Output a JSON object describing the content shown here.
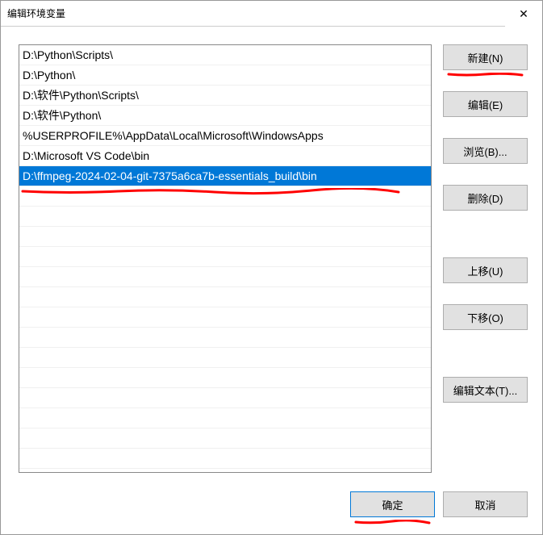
{
  "dialog": {
    "title": "编辑环境变量"
  },
  "paths": [
    "D:\\Python\\Scripts\\",
    "D:\\Python\\",
    "D:\\软件\\Python\\Scripts\\",
    "D:\\软件\\Python\\",
    "%USERPROFILE%\\AppData\\Local\\Microsoft\\WindowsApps",
    "D:\\Microsoft VS Code\\bin",
    "D:\\ffmpeg-2024-02-04-git-7375a6ca7b-essentials_build\\bin"
  ],
  "selectedIndex": 6,
  "buttons": {
    "new": "新建(N)",
    "edit": "编辑(E)",
    "browse": "浏览(B)...",
    "delete": "删除(D)",
    "moveUp": "上移(U)",
    "moveDown": "下移(O)",
    "editText": "编辑文本(T)...",
    "ok": "确定",
    "cancel": "取消"
  }
}
